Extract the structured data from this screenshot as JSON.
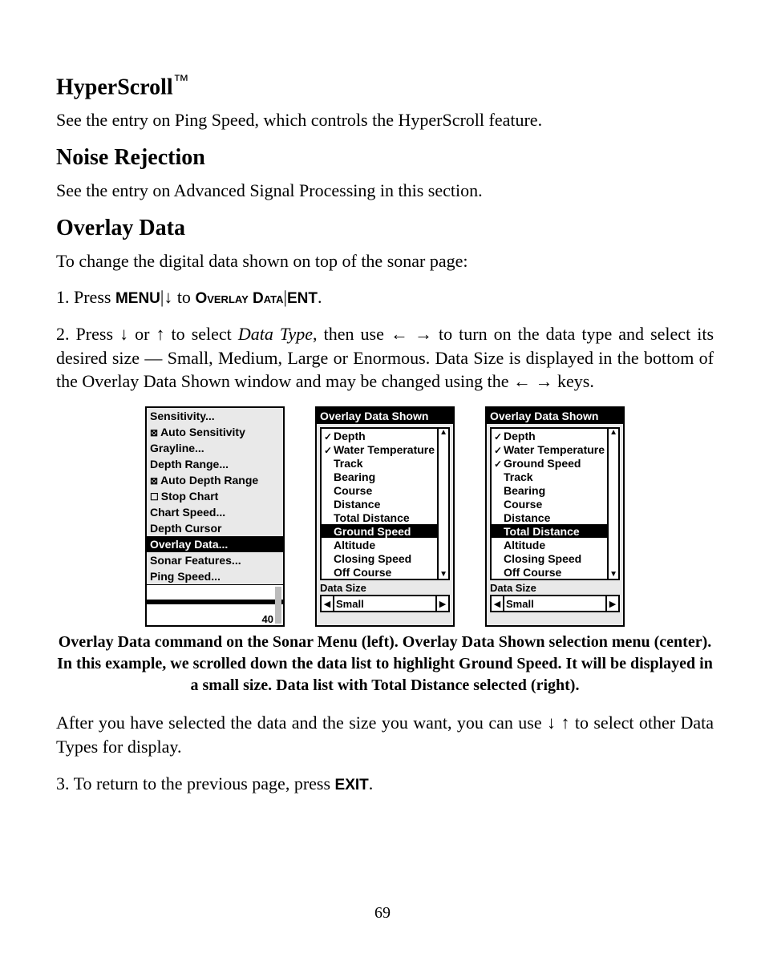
{
  "page_number": "69",
  "h_hyperscroll": "HyperScroll",
  "tm": "™",
  "p_hyperscroll": "See the entry on Ping Speed, which controls the HyperScroll feature.",
  "h_noise": "Noise Rejection",
  "p_noise": "See the entry on Advanced Signal Processing in this section.",
  "h_overlay": "Overlay Data",
  "p_overlay_intro": "To change the digital data shown on top of the sonar page:",
  "step1": {
    "prefix": "1. Press ",
    "menu": "MENU",
    "sep1": "|",
    "arrow_down": "↓",
    "to": " to ",
    "overlay_data": "Overlay Data",
    "sep2": "|",
    "ent": "ENT",
    "period": "."
  },
  "step2": {
    "prefix": "2. Press ",
    "down": "↓",
    "or": " or ",
    "up": "↑",
    "mid1": " to select ",
    "datatype": "Data Type",
    "mid2": ", then use ",
    "left": "←",
    "right": "→",
    "rest": " to turn on the data type and select its desired size — Small, Medium, Large or Enormous. Data Size is displayed in the bottom of the Overlay Data Shown window and may be changed using the ",
    "left2": "←",
    "right2": "→",
    "keys": " keys."
  },
  "caption": "Overlay Data command on the Sonar Menu (left). Overlay Data Shown selection menu (center). In this example, we scrolled down the data list to highlight Ground Speed. It will be displayed in a small size. Data list with Total Distance selected (right).",
  "p_after1": "After you have selected the data and the size you want, you can use ",
  "p_after_down": "↓",
  "p_after_up": "↑",
  "p_after2": " to select other Data Types for display.",
  "step3_prefix": "3. To return to the previous page, press ",
  "step3_exit": "EXIT",
  "step3_period": ".",
  "sonar_menu": {
    "items": [
      {
        "label": "Sensitivity...",
        "type": "plain"
      },
      {
        "label": "Auto Sensitivity",
        "type": "chk"
      },
      {
        "label": "Grayline...",
        "type": "plain"
      },
      {
        "label": "Depth Range...",
        "type": "plain"
      },
      {
        "label": "Auto Depth Range",
        "type": "chk"
      },
      {
        "label": "Stop Chart",
        "type": "unchk"
      },
      {
        "label": "Chart Speed...",
        "type": "plain"
      },
      {
        "label": "Depth Cursor",
        "type": "plain"
      },
      {
        "label": "Overlay Data...",
        "type": "plain",
        "selected": true
      },
      {
        "label": "Sonar Features...",
        "type": "plain"
      },
      {
        "label": "Ping Speed...",
        "type": "plain"
      }
    ],
    "depth_num": "40"
  },
  "ods_center": {
    "title": "Overlay Data Shown",
    "items": [
      {
        "label": "Depth",
        "checked": true
      },
      {
        "label": "Water Temperature",
        "checked": true
      },
      {
        "label": "Track"
      },
      {
        "label": "Bearing"
      },
      {
        "label": "Course"
      },
      {
        "label": "Distance"
      },
      {
        "label": "Total Distance"
      },
      {
        "label": "Ground Speed",
        "selected": true
      },
      {
        "label": "Altitude"
      },
      {
        "label": "Closing Speed"
      },
      {
        "label": "Off Course"
      }
    ],
    "size_label": "Data Size",
    "size_value": "Small"
  },
  "ods_right": {
    "title": "Overlay Data Shown",
    "items": [
      {
        "label": "Depth",
        "checked": true
      },
      {
        "label": "Water Temperature",
        "checked": true
      },
      {
        "label": "Ground Speed",
        "checked": true
      },
      {
        "label": "Track"
      },
      {
        "label": "Bearing"
      },
      {
        "label": "Course"
      },
      {
        "label": "Distance"
      },
      {
        "label": "Total Distance",
        "selected": true
      },
      {
        "label": "Altitude"
      },
      {
        "label": "Closing Speed"
      },
      {
        "label": "Off Course"
      }
    ],
    "size_label": "Data Size",
    "size_value": "Small"
  }
}
